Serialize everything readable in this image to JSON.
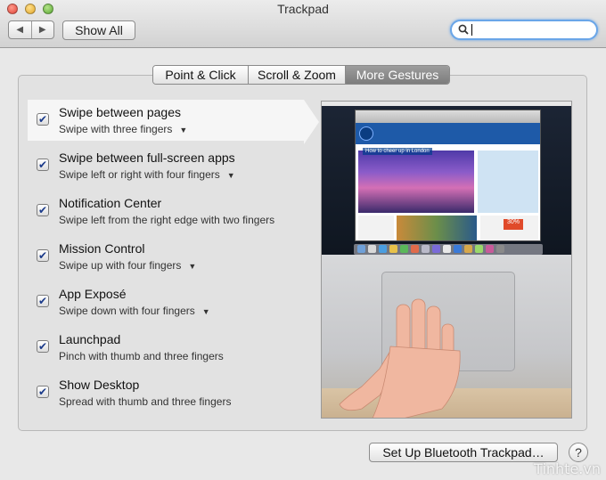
{
  "window": {
    "title": "Trackpad"
  },
  "toolbar": {
    "back_icon": "◀",
    "forward_icon": "▶",
    "show_all_label": "Show All",
    "search_value": ""
  },
  "tabs": [
    {
      "label": "Point & Click",
      "selected": false
    },
    {
      "label": "Scroll & Zoom",
      "selected": false
    },
    {
      "label": "More Gestures",
      "selected": true
    }
  ],
  "gestures": [
    {
      "title": "Swipe between pages",
      "subtitle": "Swipe with three fingers",
      "checked": true,
      "has_dropdown": true,
      "selected": true
    },
    {
      "title": "Swipe between full-screen apps",
      "subtitle": "Swipe left or right with four fingers",
      "checked": true,
      "has_dropdown": true
    },
    {
      "title": "Notification Center",
      "subtitle": "Swipe left from the right edge with two fingers",
      "checked": true,
      "has_dropdown": false
    },
    {
      "title": "Mission Control",
      "subtitle": "Swipe up with four fingers",
      "checked": true,
      "has_dropdown": true
    },
    {
      "title": "App Exposé",
      "subtitle": "Swipe down with four fingers",
      "checked": true,
      "has_dropdown": true
    },
    {
      "title": "Launchpad",
      "subtitle": "Pinch with thumb and three fingers",
      "checked": true,
      "has_dropdown": false
    },
    {
      "title": "Show Desktop",
      "subtitle": "Spread with thumb and three fingers",
      "checked": true,
      "has_dropdown": false
    }
  ],
  "preview": {
    "hero_caption": "How to cheer up in London",
    "badge": "30%"
  },
  "footer": {
    "bluetooth_button_label": "Set Up Bluetooth Trackpad…",
    "help_label": "?"
  },
  "watermark": "Tinhte.vn",
  "colors": {
    "accent": "#1a3a8a",
    "selected_tab": "#8a8a8a"
  }
}
